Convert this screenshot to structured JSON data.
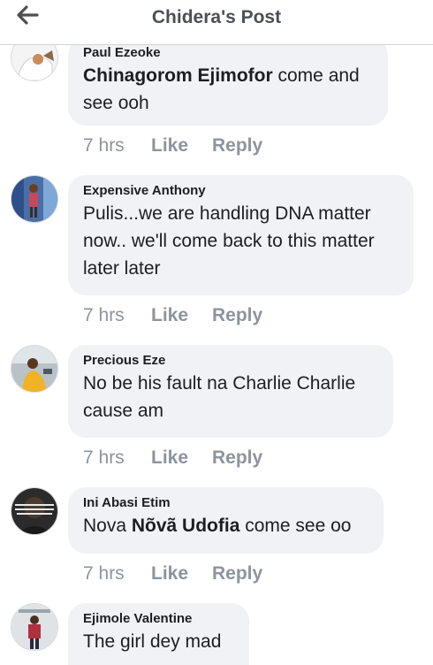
{
  "header": {
    "title": "Chidera's Post"
  },
  "comments": [
    {
      "author": "Paul Ezeoke",
      "mention": "Chinagorom Ejimofor",
      "text": " come and see ooh",
      "time": "7 hrs",
      "like": "Like",
      "reply": "Reply"
    },
    {
      "author": "Expensive Anthony",
      "text": "Pulis...we are handling DNA matter now.. we'll come back to this matter later later",
      "time": "7 hrs",
      "like": "Like",
      "reply": "Reply"
    },
    {
      "author": "Precious Eze",
      "text": "No be his fault na Charlie Charlie cause am",
      "time": "7 hrs",
      "like": "Like",
      "reply": "Reply"
    },
    {
      "author": "Ini Abasi Etim",
      "prefix": "Nova ",
      "mention": "Nõvã Udofia",
      "text": " come see oo",
      "time": "7 hrs",
      "like": "Like",
      "reply": "Reply"
    },
    {
      "author": "Ejimole Valentine",
      "text": "The girl dey mad"
    }
  ]
}
